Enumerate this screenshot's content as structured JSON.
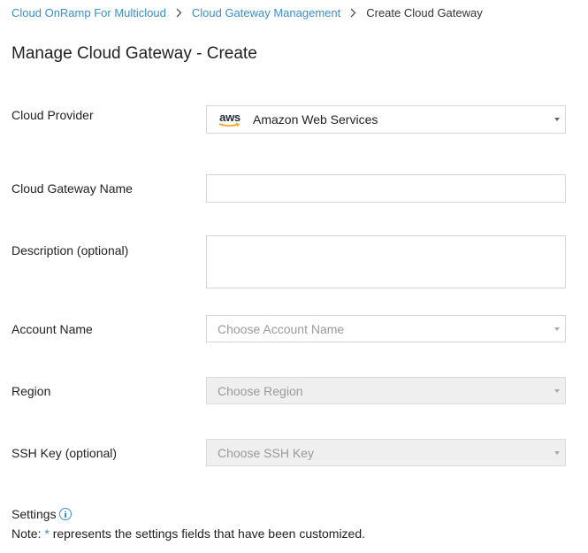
{
  "breadcrumb": {
    "items": [
      "Cloud OnRamp For Multicloud",
      "Cloud Gateway Management"
    ],
    "current": "Create Cloud Gateway"
  },
  "page": {
    "title": "Manage Cloud Gateway - Create"
  },
  "form": {
    "cloud_provider": {
      "label": "Cloud Provider",
      "logo_text": "aws",
      "value": "Amazon Web Services"
    },
    "gateway_name": {
      "label": "Cloud Gateway Name",
      "value": ""
    },
    "description": {
      "label": "Description (optional)",
      "value": ""
    },
    "account_name": {
      "label": "Account Name",
      "placeholder": "Choose Account Name"
    },
    "region": {
      "label": "Region",
      "placeholder": "Choose Region"
    },
    "ssh_key": {
      "label": "SSH Key (optional)",
      "placeholder": "Choose SSH Key"
    }
  },
  "settings": {
    "label": "Settings",
    "note_prefix": "Note: ",
    "asterisk": "*",
    "note_suffix": " represents the settings fields that have been customized."
  },
  "colors": {
    "link": "#3a8fd0",
    "aws_smile": "#ff9900"
  }
}
